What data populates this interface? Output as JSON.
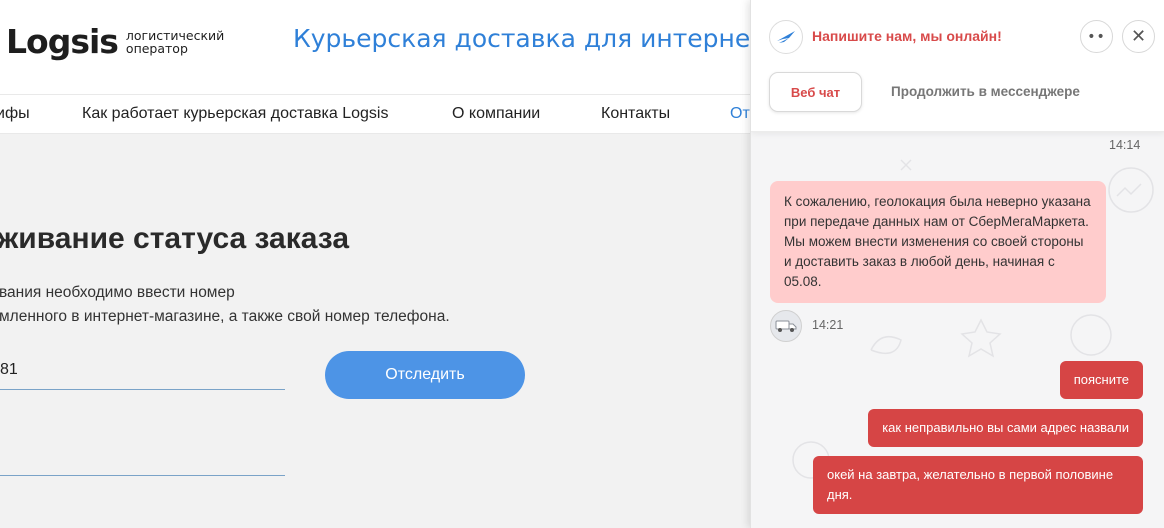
{
  "site": {
    "logo": {
      "word": "Logsis",
      "sub_line1": "логистический",
      "sub_line2": "оператор"
    },
    "headline": "Курьерская доставка для интернет-м",
    "nav": [
      {
        "label": "ифы"
      },
      {
        "label": "Как работает курьерская доставка Logsis"
      },
      {
        "label": "О компании"
      },
      {
        "label": "Контакты"
      },
      {
        "label": "От"
      }
    ],
    "tracking": {
      "title": "живание статуса заказа",
      "desc_line1": "вания необходимо ввести номер",
      "desc_line2": "мленного в интернет-магазине, а также свой номер телефона.",
      "order_value": "81",
      "phone_value": "",
      "button_label": "Отследить"
    }
  },
  "chat": {
    "prompt": "Напишите нам, мы онлайн!",
    "more_label": "••",
    "close_label": "✕",
    "tab_web": "Веб чат",
    "tab_messenger": "Продолжить в мессенджере",
    "time_top": "14:14",
    "incoming": {
      "text": "К сожалению, геолокация была неверно указана при передаче данных нам от СберМегаМаркета. Мы можем внести изменения со своей стороны и доставить заказ в любой день, начиная с 05.08.",
      "time": "14:21"
    },
    "outgoing": [
      {
        "text": "поясните"
      },
      {
        "text": "как неправильно вы сами адрес назвали"
      },
      {
        "text": "окей на завтра, желательно в первой половине дня."
      }
    ],
    "colors": {
      "accent": "#d84a4a",
      "incoming_bg": "#ffcccc",
      "outgoing_bg": "#d64545",
      "brand_blue": "#2f80d8"
    }
  }
}
